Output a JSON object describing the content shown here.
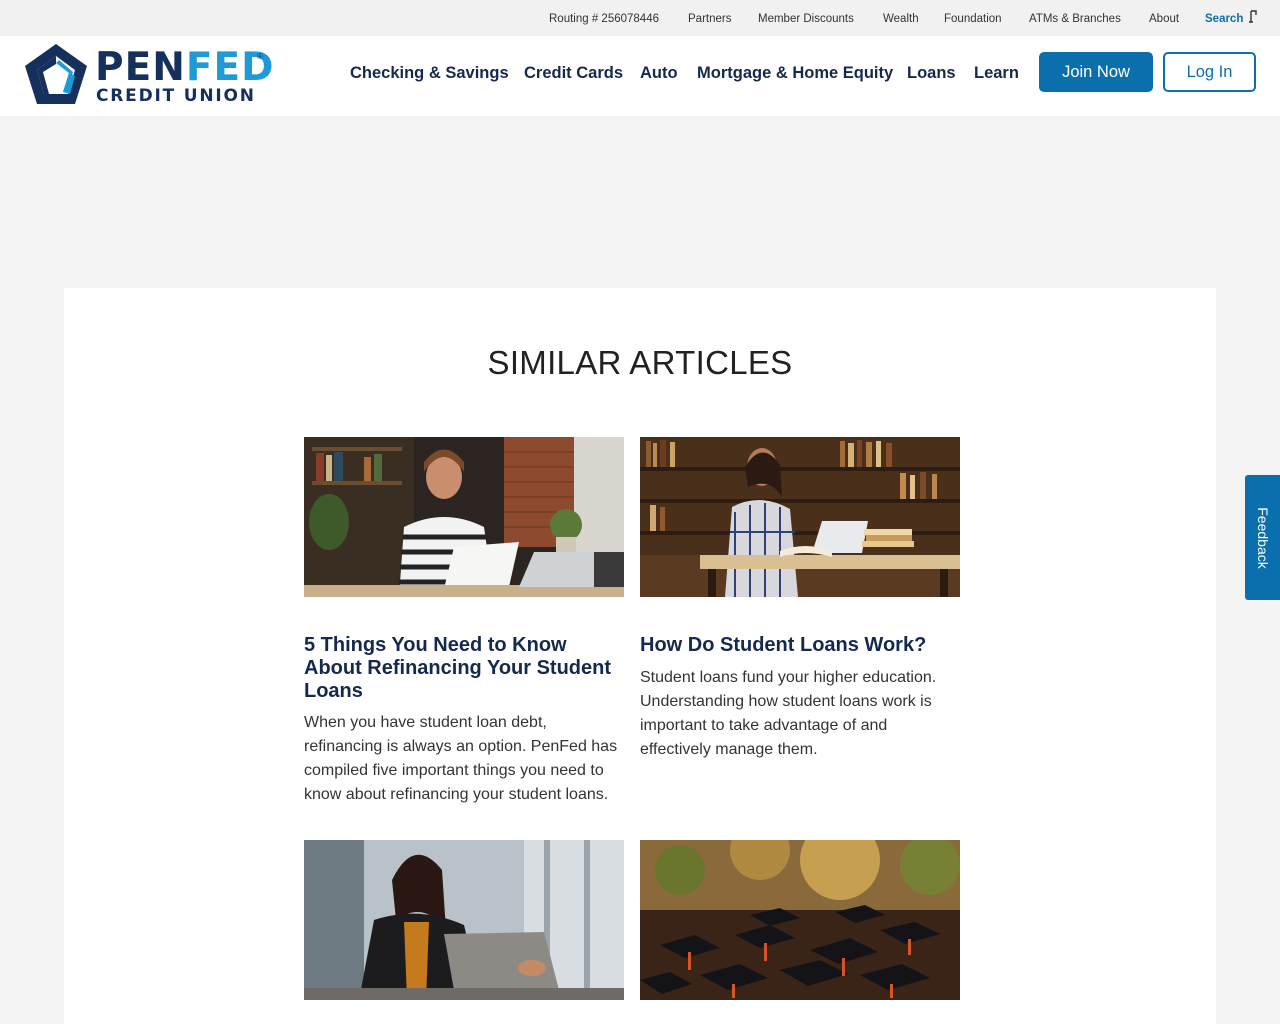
{
  "utility_bar": {
    "routing": "Routing # 256078446",
    "links": [
      "Partners",
      "Member Discounts",
      "Wealth",
      "Foundation",
      "ATMs & Branches",
      "About"
    ],
    "search_label": "Search",
    "search_icon": "magnifier-icon"
  },
  "header": {
    "logo": {
      "pen": "PEN",
      "fed": "FED",
      "reg": "®",
      "sub": "CREDIT UNION",
      "icon": "pentagon-logo-icon"
    },
    "nav": [
      "Checking & Savings",
      "Credit Cards",
      "Auto",
      "Mortgage & Home Equity",
      "Loans",
      "Learn"
    ],
    "join_label": "Join Now",
    "login_label": "Log In"
  },
  "similar": {
    "heading": "SIMILAR ARTICLES",
    "articles": [
      {
        "title": "5 Things You Need to Know About Refinancing Your Student Loans",
        "description": "When you have student loan debt, refinancing is always an option. PenFed has compiled five important things you need to know about refinancing your student loans."
      },
      {
        "title": "How Do Student Loans Work?",
        "description": "Student loans fund your higher education. Understanding how student loans work is important to take advantage of and effectively manage them."
      }
    ]
  },
  "feedback_label": "Feedback",
  "colors": {
    "brand_navy": "#15294f",
    "brand_blue": "#0b6fae",
    "brand_light_blue": "#1e9ad6",
    "page_bg": "#f3f3f3"
  }
}
